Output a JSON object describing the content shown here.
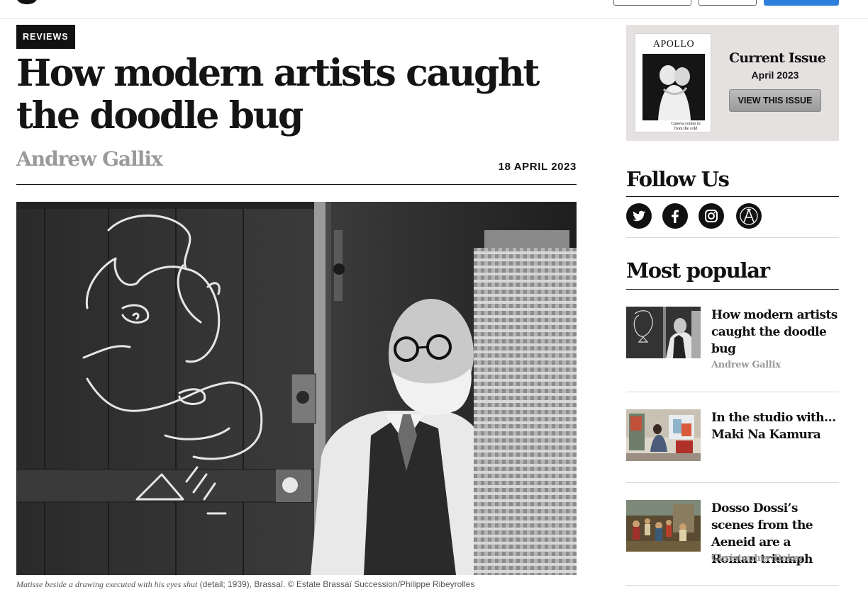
{
  "article": {
    "category": "REVIEWS",
    "title": "How modern artists caught the doodle bug",
    "author": "Andrew Gallix",
    "date": "18 APRIL 2023",
    "caption_italic": "Matisse beside a drawing executed with his eyes shut",
    "caption_rest": " (detail; 1939), Brassaï. © Estate Brassaï Succession/Philippe Ribeyrolles"
  },
  "current_issue": {
    "cover_title": "APOLLO",
    "cover_subtitle": "Canova comes in from the cold",
    "heading": "Current Issue",
    "date": "April 2023",
    "button": "VIEW THIS ISSUE"
  },
  "follow": {
    "heading": "Follow Us",
    "icons": [
      "twitter-icon",
      "facebook-icon",
      "instagram-icon",
      "apollo-icon"
    ]
  },
  "popular": {
    "heading": "Most popular",
    "items": [
      {
        "title": "How modern artists caught the doodle bug",
        "author": "Andrew Gallix"
      },
      {
        "title": "In the studio with… Maki Na Kamura",
        "author": ""
      },
      {
        "title": "Dosso Dossi’s scenes from the Aeneid are a Roman triumph",
        "author": "Christopher Baker"
      }
    ]
  },
  "colors": {
    "accent_blue": "#2f7fde",
    "author_grey": "#9a9a9a",
    "issue_box": "#e6e1e1"
  }
}
